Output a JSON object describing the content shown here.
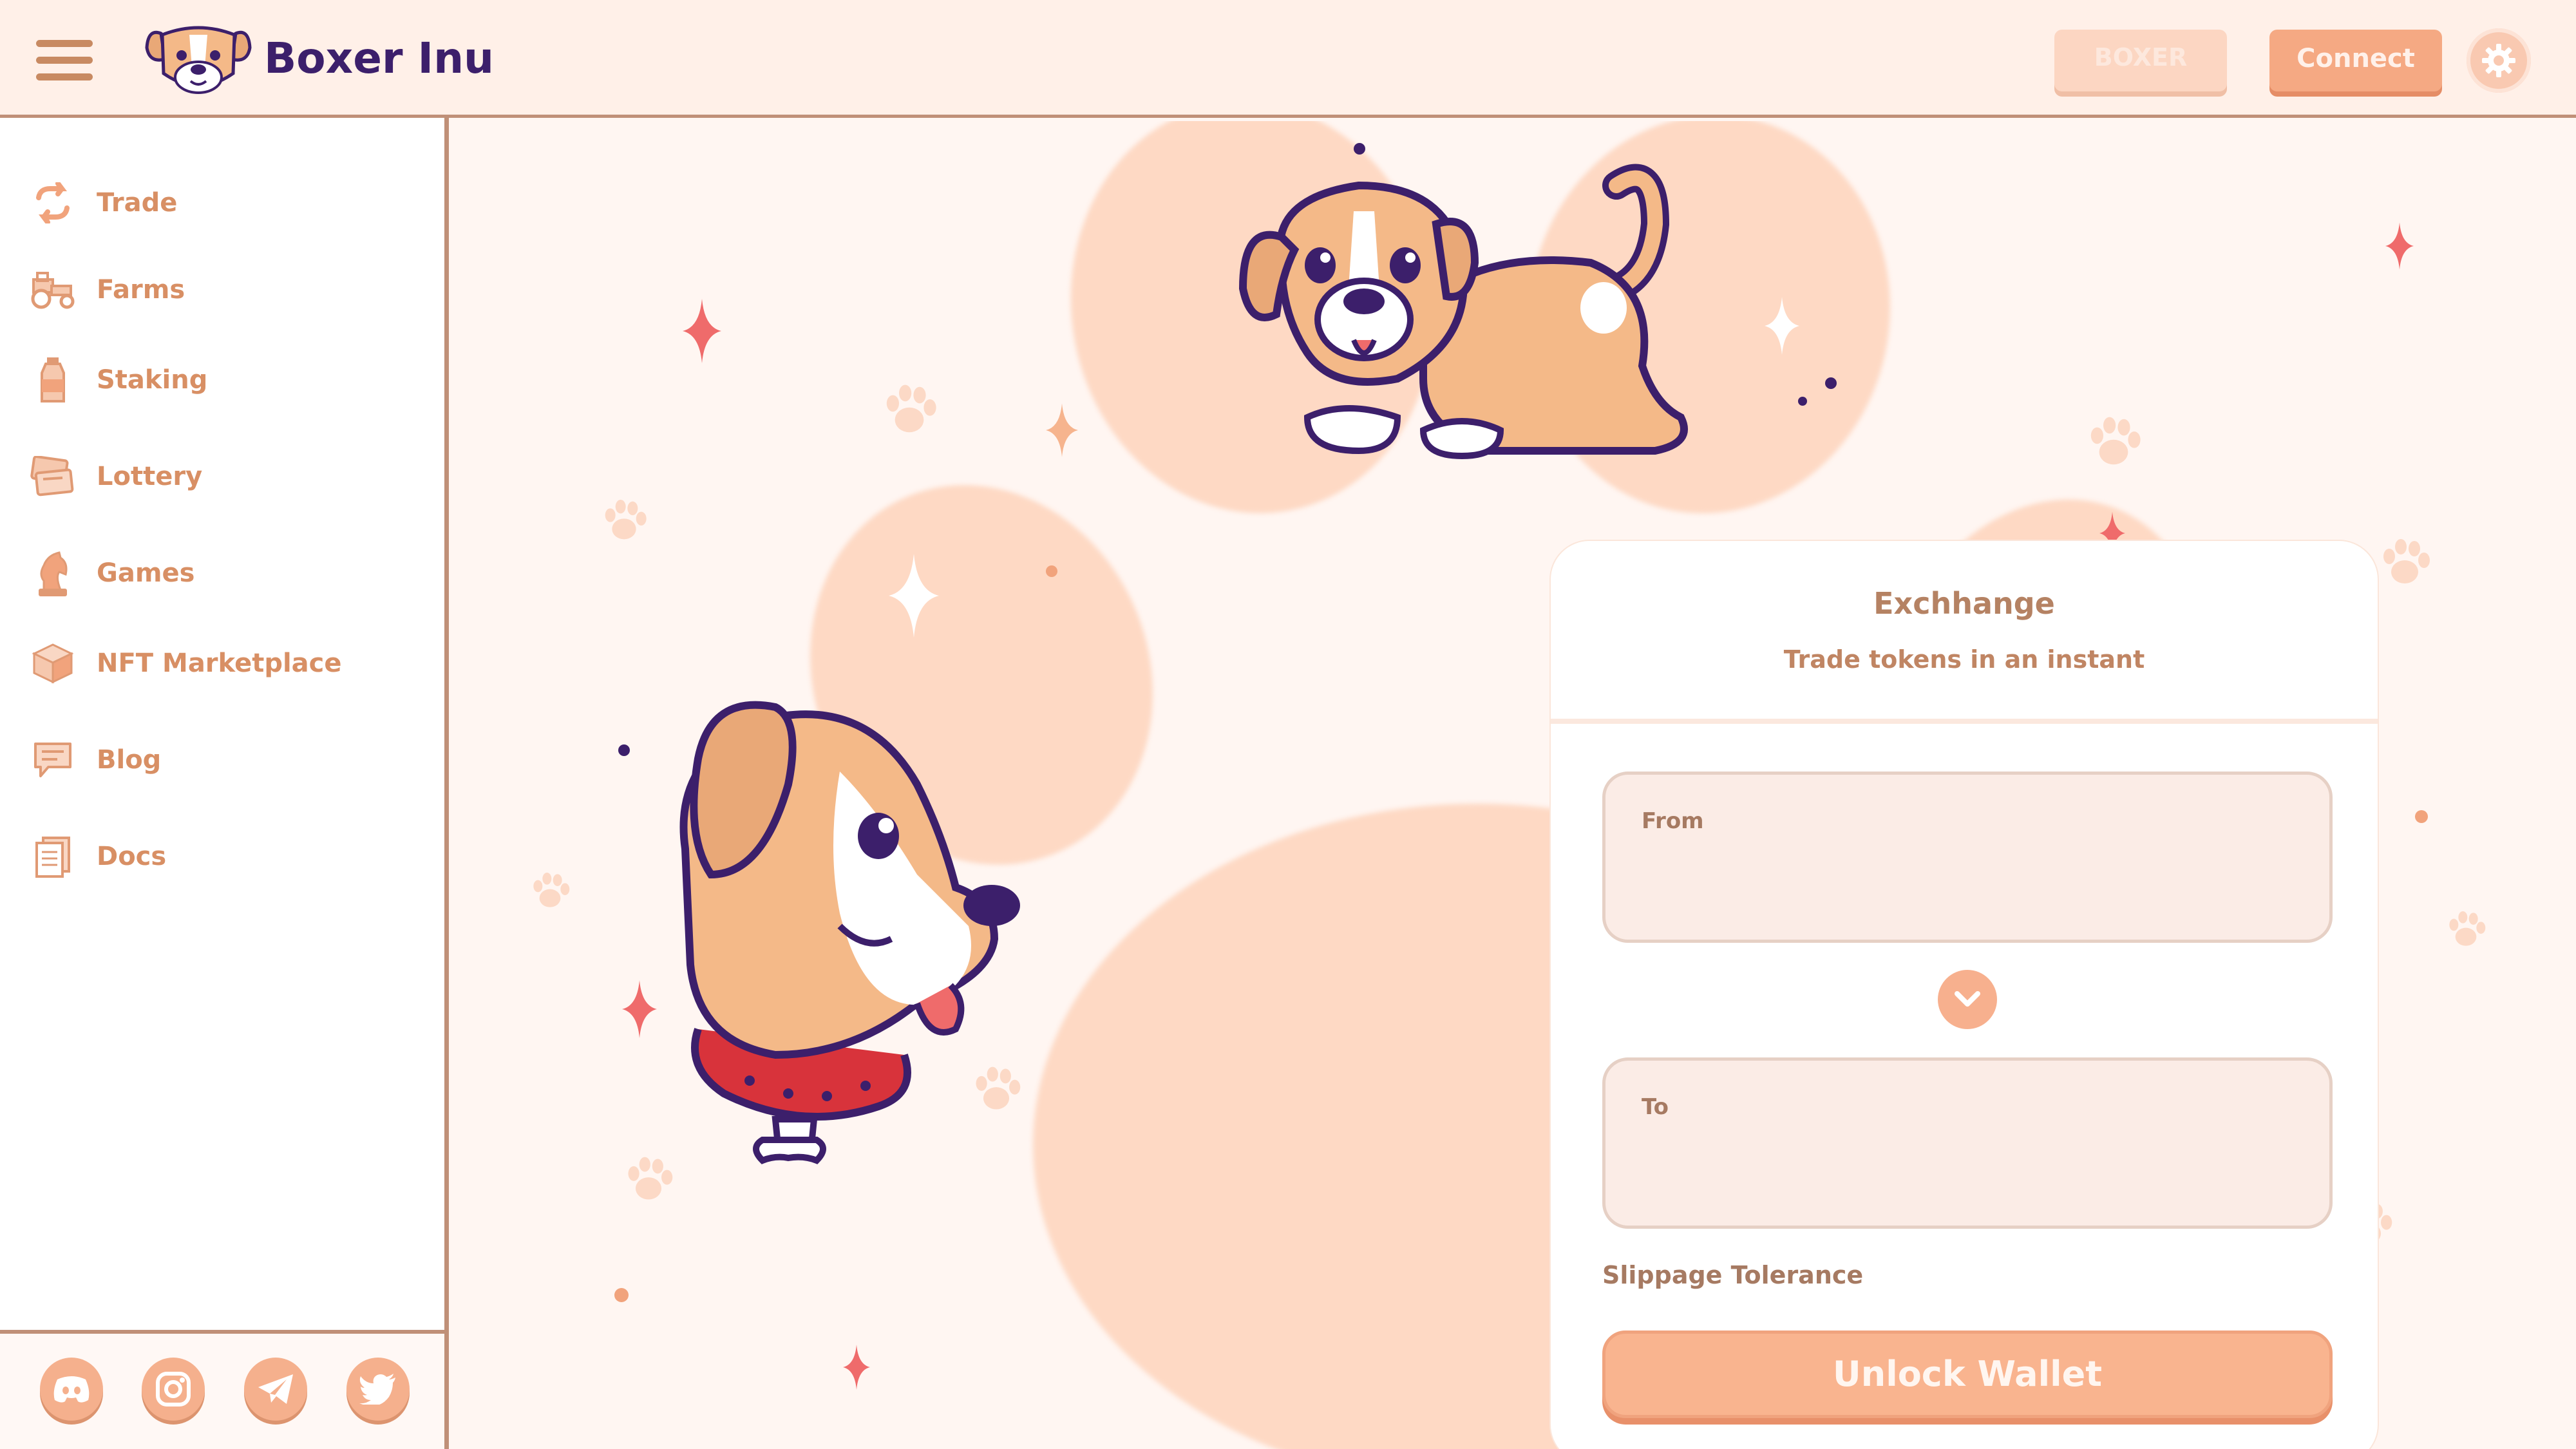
{
  "header": {
    "brand": "Boxer Inu",
    "token_button": "BOXER",
    "connect_button": "Connect"
  },
  "sidebar": {
    "items": [
      {
        "label": "Trade",
        "icon": "swap-arrows-icon"
      },
      {
        "label": "Farms",
        "icon": "tractor-icon"
      },
      {
        "label": "Staking",
        "icon": "bottle-icon"
      },
      {
        "label": "Lottery",
        "icon": "tickets-icon"
      },
      {
        "label": "Games",
        "icon": "chess-knight-icon"
      },
      {
        "label": "NFT Marketplace",
        "icon": "cube-icon"
      },
      {
        "label": "Blog",
        "icon": "chat-bubble-icon"
      },
      {
        "label": "Docs",
        "icon": "documents-icon"
      }
    ],
    "socials": [
      "discord-icon",
      "instagram-icon",
      "telegram-icon",
      "twitter-icon"
    ]
  },
  "exchange": {
    "title": "Exchhange",
    "subtitle": "Trade tokens in an instant",
    "from_label": "From",
    "to_label": "To",
    "slippage_label": "Slippage Tolerance",
    "unlock_button": "Unlock Wallet"
  },
  "colors": {
    "accent": "#f5a983",
    "brand_text": "#3c1f6b",
    "background": "#fff6f2",
    "border": "#c09078"
  }
}
